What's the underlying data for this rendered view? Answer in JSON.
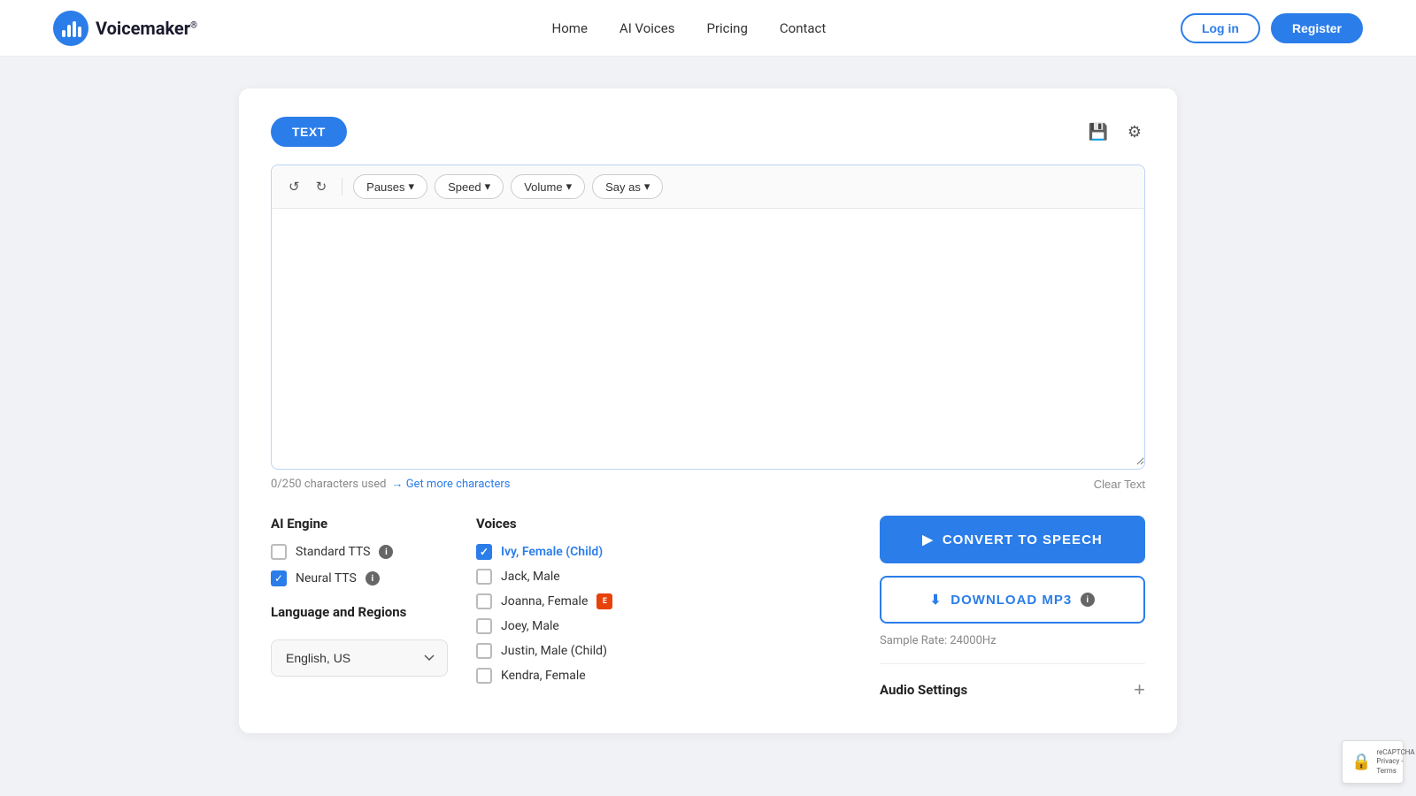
{
  "navbar": {
    "logo_text": "Voicemaker",
    "logo_sup": "®",
    "nav_links": [
      "Home",
      "AI Voices",
      "Pricing",
      "Contact"
    ],
    "login_label": "Log in",
    "register_label": "Register"
  },
  "card": {
    "text_tab_label": "TEXT",
    "save_icon": "💾",
    "settings_icon": "⚙"
  },
  "toolbar": {
    "undo_label": "↺",
    "redo_label": "↻",
    "pauses_label": "Pauses",
    "speed_label": "Speed",
    "volume_label": "Volume",
    "say_as_label": "Say as"
  },
  "editor": {
    "placeholder": "",
    "char_count": "0/250 characters used",
    "get_more_label": "→ Get more characters",
    "clear_text_label": "Clear Text"
  },
  "ai_engine": {
    "section_label": "AI Engine",
    "standard_tts_label": "Standard TTS",
    "neural_tts_label": "Neural TTS",
    "standard_checked": false,
    "neural_checked": true
  },
  "language": {
    "section_label": "Language and Regions",
    "selected": "English, US"
  },
  "voices": {
    "section_label": "Voices",
    "items": [
      {
        "label": "Ivy, Female (Child)",
        "selected": true,
        "badge": ""
      },
      {
        "label": "Jack, Male",
        "selected": false,
        "badge": ""
      },
      {
        "label": "Joanna, Female",
        "selected": false,
        "badge": "E"
      },
      {
        "label": "Joey, Male",
        "selected": false,
        "badge": ""
      },
      {
        "label": "Justin, Male (Child)",
        "selected": false,
        "badge": ""
      },
      {
        "label": "Kendra, Female",
        "selected": false,
        "badge": ""
      }
    ]
  },
  "actions": {
    "convert_label": "CONVERT TO SPEECH",
    "download_label": "DOWNLOAD MP3",
    "sample_rate": "Sample Rate: 24000Hz",
    "audio_settings_label": "Audio Settings"
  }
}
